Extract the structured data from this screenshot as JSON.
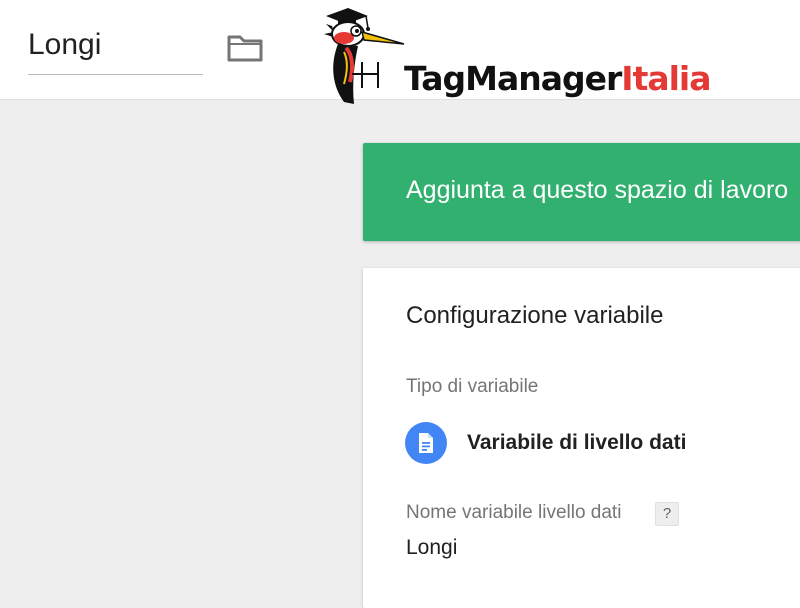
{
  "header": {
    "container_name": "Longi",
    "folder_icon": "folder-icon",
    "logo": {
      "text_primary": "TagManager",
      "text_accent": "Italia",
      "accent_color": "#e53935",
      "mascot_icon": "woodpecker-graduate-mascot"
    }
  },
  "banner": {
    "message": "Aggiunta a questo spazio di lavoro",
    "color": "#32b06f"
  },
  "variable_config": {
    "title": "Configurazione variabile",
    "type_label": "Tipo di variabile",
    "type_value": "Variabile di livello dati",
    "type_icon": "document-icon",
    "type_icon_color": "#4285f4",
    "dl_name_label": "Nome variabile livello dati",
    "help_icon": "?",
    "dl_name_value": "Longi"
  }
}
